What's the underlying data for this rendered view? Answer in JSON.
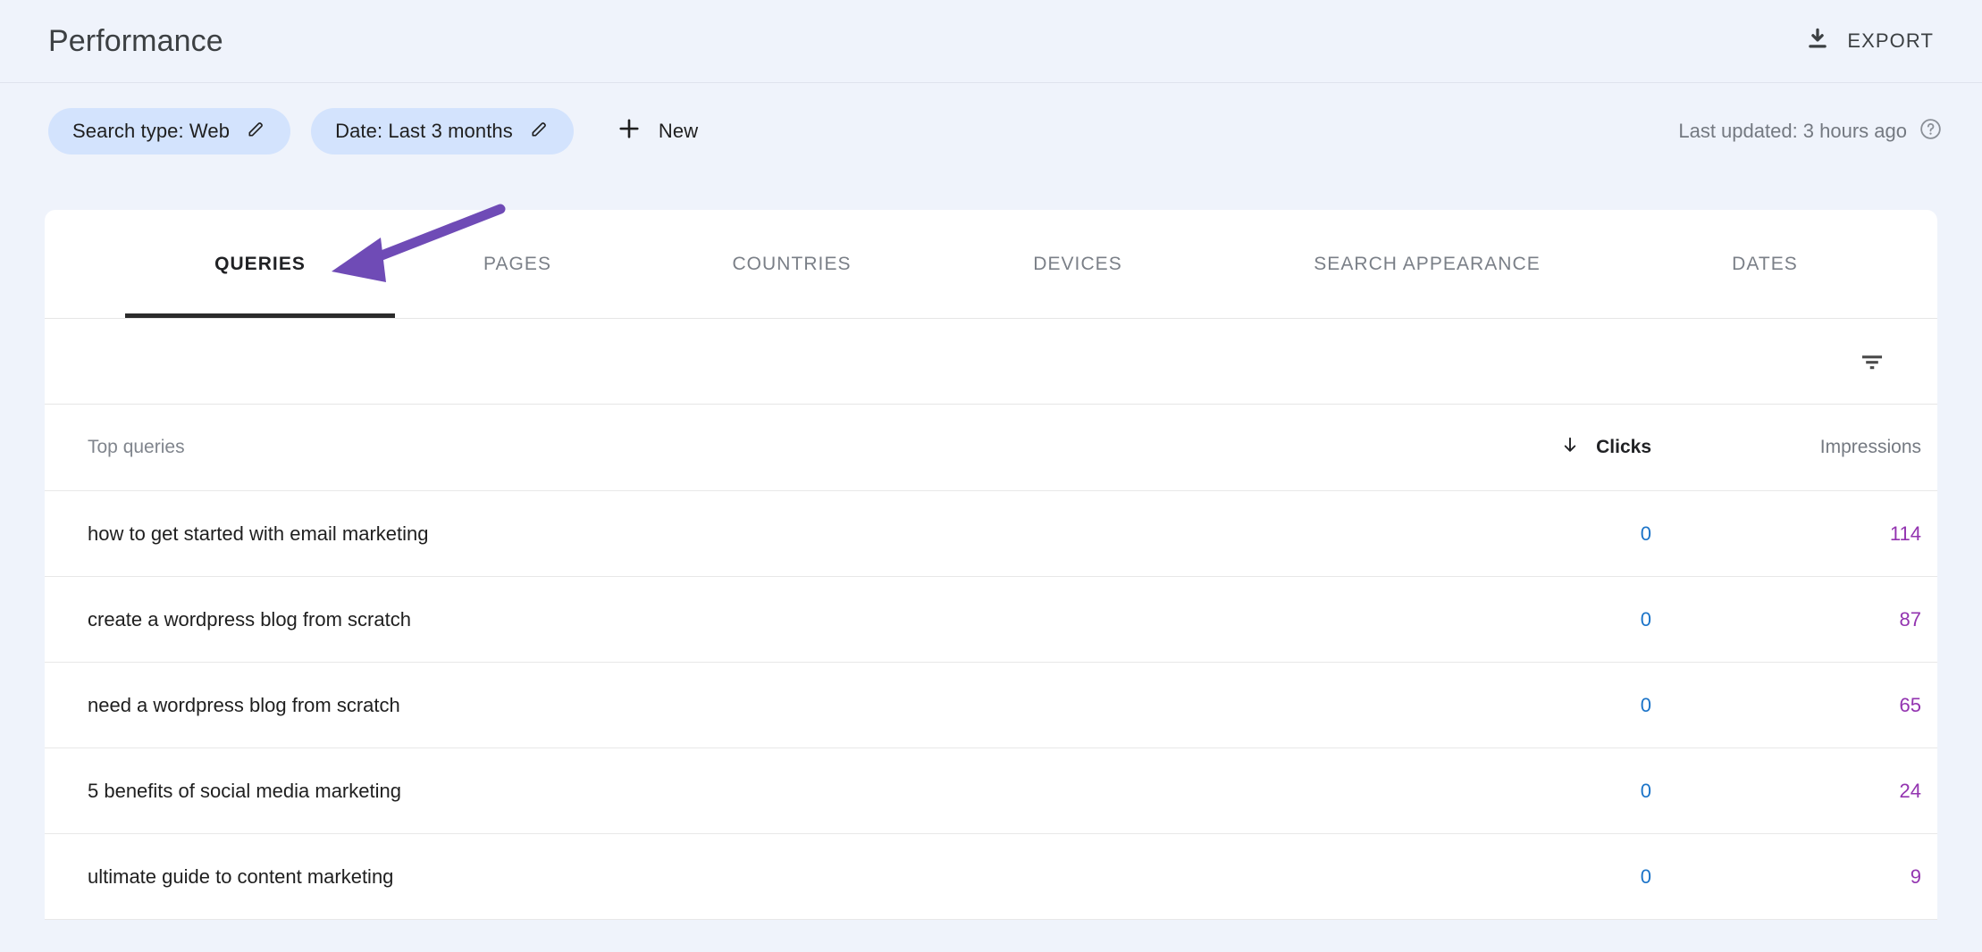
{
  "header": {
    "title": "Performance",
    "export_label": "EXPORT",
    "export_icon": "download-icon"
  },
  "filter_bar": {
    "chips": [
      {
        "label": "Search type: Web",
        "edit_icon": "pencil-icon"
      },
      {
        "label": "Date: Last 3 months",
        "edit_icon": "pencil-icon"
      }
    ],
    "new_button": {
      "label": "New",
      "icon": "plus-icon"
    },
    "last_updated": {
      "text": "Last updated: 3 hours ago",
      "icon": "help-circle-icon"
    }
  },
  "tabs": [
    {
      "label": "QUERIES",
      "active": true
    },
    {
      "label": "PAGES",
      "active": false
    },
    {
      "label": "COUNTRIES",
      "active": false
    },
    {
      "label": "DEVICES",
      "active": false
    },
    {
      "label": "SEARCH APPEARANCE",
      "active": false
    },
    {
      "label": "DATES",
      "active": false
    }
  ],
  "toolbar": {
    "filter_icon": "filter-icon"
  },
  "table": {
    "columns": {
      "query": "Top queries",
      "clicks": "Clicks",
      "impressions": "Impressions"
    },
    "sort": {
      "column": "Clicks",
      "direction": "desc",
      "icon": "arrow-down-icon"
    },
    "rows": [
      {
        "query": "how to get started with email marketing",
        "clicks": "0",
        "impressions": "114"
      },
      {
        "query": "create a wordpress blog from scratch",
        "clicks": "0",
        "impressions": "87"
      },
      {
        "query": "need a wordpress blog from scratch",
        "clicks": "0",
        "impressions": "65"
      },
      {
        "query": "5 benefits of social media marketing",
        "clicks": "0",
        "impressions": "24"
      },
      {
        "query": "ultimate guide to content marketing",
        "clicks": "0",
        "impressions": "9"
      }
    ]
  },
  "annotation": {
    "type": "arrow",
    "points_to": "QUERIES",
    "color": "#6f4bb6"
  },
  "colors": {
    "page_background": "#eff3fb",
    "card_background": "#ffffff",
    "chip_background": "#d3e3fd",
    "clicks_value": "#1a73c8",
    "impressions_value": "#9334b0",
    "active_tab": "#202124",
    "inactive_tab": "#7a7f87"
  }
}
